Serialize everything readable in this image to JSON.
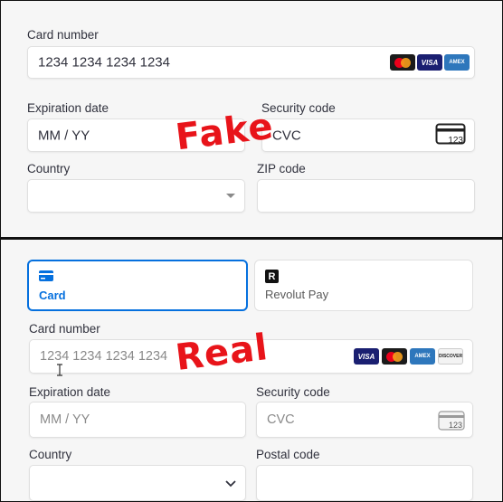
{
  "fake": {
    "stamp": "Fake",
    "card_number": {
      "label": "Card number",
      "value": "1234 1234 1234 1234"
    },
    "expiration": {
      "label": "Expiration date",
      "value": "MM / YY"
    },
    "security": {
      "label": "Security code",
      "value": "CVC",
      "icon_text": "123"
    },
    "country": {
      "label": "Country",
      "value": ""
    },
    "zip": {
      "label": "ZIP code",
      "value": ""
    },
    "brands": [
      "mastercard",
      "visa",
      "amex"
    ]
  },
  "real": {
    "stamp": "Real",
    "tabs": [
      {
        "label": "Card",
        "icon": "card-icon",
        "selected": true
      },
      {
        "label": "Revolut Pay",
        "icon": "revolut-icon",
        "selected": false
      }
    ],
    "card_number": {
      "label": "Card number",
      "placeholder": "1234 1234 1234 1234"
    },
    "expiration": {
      "label": "Expiration date",
      "placeholder": "MM / YY"
    },
    "security": {
      "label": "Security code",
      "placeholder": "CVC",
      "icon_text": "123"
    },
    "country": {
      "label": "Country",
      "value": ""
    },
    "postal": {
      "label": "Postal code",
      "value": ""
    },
    "brands": [
      "visa",
      "mastercard",
      "amex",
      "discover"
    ]
  },
  "brand_text": {
    "visa": "VISA",
    "amex": "AMEX",
    "discover": "DISCOVER",
    "revolut": "R"
  },
  "colors": {
    "accent": "#0570de",
    "stamp": "#e8141a"
  }
}
